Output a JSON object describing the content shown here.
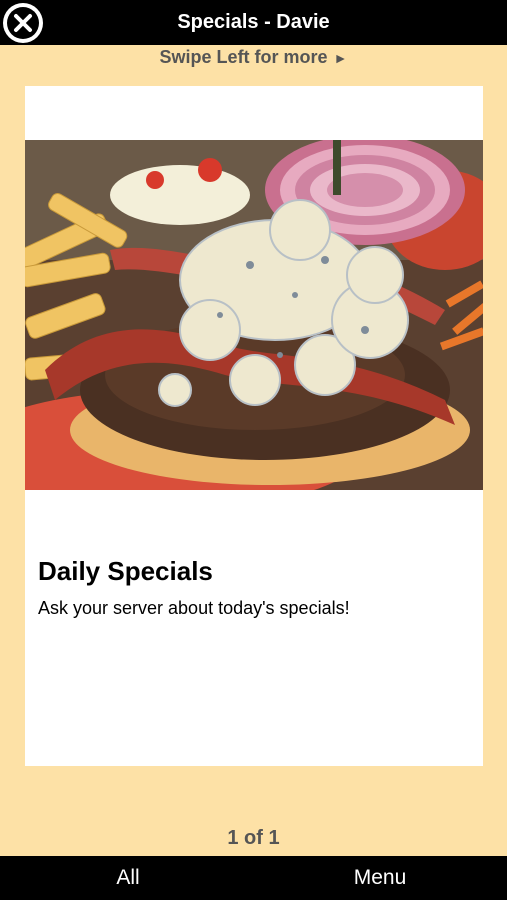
{
  "header": {
    "title": "Specials - Davie",
    "close_icon": "close-icon"
  },
  "swipe_hint": {
    "label": "Swipe Left for more",
    "arrow": "►"
  },
  "special": {
    "image_description_icon": "food-photo",
    "title": "Daily Specials",
    "description": "Ask your server about today's specials!"
  },
  "pager": {
    "label": "1 of 1"
  },
  "bottom_nav": {
    "all_label": "All",
    "menu_label": "Menu"
  },
  "colors": {
    "background": "#fde1a6",
    "bar": "#000000",
    "card": "#ffffff"
  }
}
